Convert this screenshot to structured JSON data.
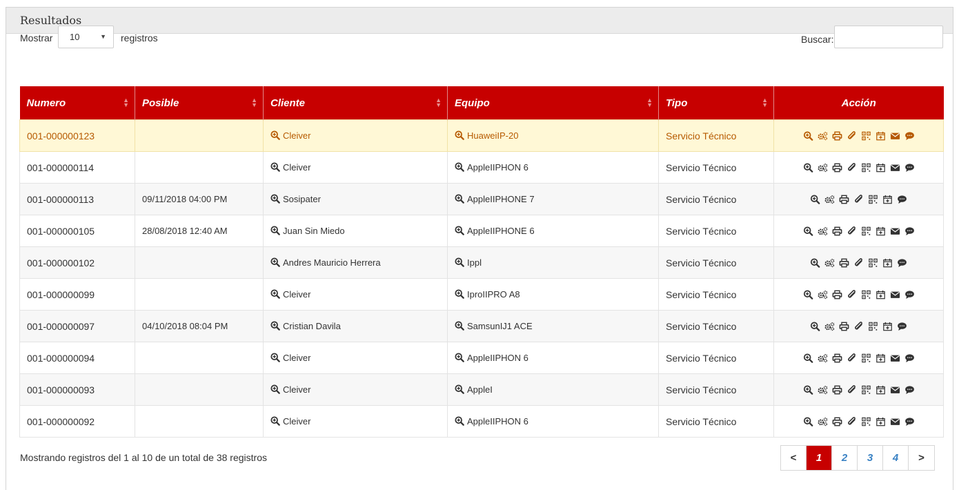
{
  "panel": {
    "title": "Resultados"
  },
  "toolbar": {
    "show_label": "Mostrar",
    "per_page_value": "10",
    "records_label": "registros",
    "search_label": "Buscar:",
    "search_value": ""
  },
  "table": {
    "headers": [
      "Numero",
      "Posible",
      "Cliente",
      "Equipo",
      "Tipo",
      "Acción"
    ],
    "rows": [
      {
        "numero": "001-000000123",
        "posible": "",
        "cliente": "Cleiver",
        "equipo": "HuaweiIP-20",
        "tipo": "Servicio Técnico",
        "has_mail": true
      },
      {
        "numero": "001-000000114",
        "posible": "",
        "cliente": "Cleiver",
        "equipo": "AppleIIPHON 6",
        "tipo": "Servicio Técnico",
        "has_mail": true
      },
      {
        "numero": "001-000000113",
        "posible": "09/11/2018 04:00 PM",
        "cliente": "Sosipater",
        "equipo": "AppleIIPHONE 7",
        "tipo": "Servicio Técnico",
        "has_mail": false
      },
      {
        "numero": "001-000000105",
        "posible": "28/08/2018 12:40 AM",
        "cliente": "Juan Sin Miedo",
        "equipo": "AppleIIPHONE 6",
        "tipo": "Servicio Técnico",
        "has_mail": true
      },
      {
        "numero": "001-000000102",
        "posible": "",
        "cliente": "Andres Mauricio Herrera",
        "equipo": "Ippl",
        "tipo": "Servicio Técnico",
        "has_mail": false
      },
      {
        "numero": "001-000000099",
        "posible": "",
        "cliente": "Cleiver",
        "equipo": "IproIIPRO A8",
        "tipo": "Servicio Técnico",
        "has_mail": true
      },
      {
        "numero": "001-000000097",
        "posible": "04/10/2018 08:04 PM",
        "cliente": "Cristian Davila",
        "equipo": "SamsunIJ1 ACE",
        "tipo": "Servicio Técnico",
        "has_mail": false
      },
      {
        "numero": "001-000000094",
        "posible": "",
        "cliente": "Cleiver",
        "equipo": "AppleIIPHON 6",
        "tipo": "Servicio Técnico",
        "has_mail": true
      },
      {
        "numero": "001-000000093",
        "posible": "",
        "cliente": "Cleiver",
        "equipo": "AppleI",
        "tipo": "Servicio Técnico",
        "has_mail": true
      },
      {
        "numero": "001-000000092",
        "posible": "",
        "cliente": "Cleiver",
        "equipo": "AppleIIPHON 6",
        "tipo": "Servicio Técnico",
        "has_mail": true
      }
    ]
  },
  "footer": {
    "summary": "Mostrando registros del 1 al 10 de un total de 38 registros"
  },
  "pagination": {
    "prev": "<",
    "pages": [
      "1",
      "2",
      "3",
      "4"
    ],
    "active": "1",
    "next": ">"
  },
  "colors": {
    "header_bg": "#c70000",
    "highlight_bg": "#fff8d6",
    "highlight_text": "#b65a00",
    "link": "#3a82c4"
  },
  "icons": {
    "link_icon": "zoom-in-icon",
    "actions": [
      "zoom-in-icon",
      "cogs-icon",
      "print-icon",
      "paperclip-icon",
      "qrcode-icon",
      "calendar-plus-icon",
      "envelope-icon",
      "comment-icon"
    ]
  }
}
